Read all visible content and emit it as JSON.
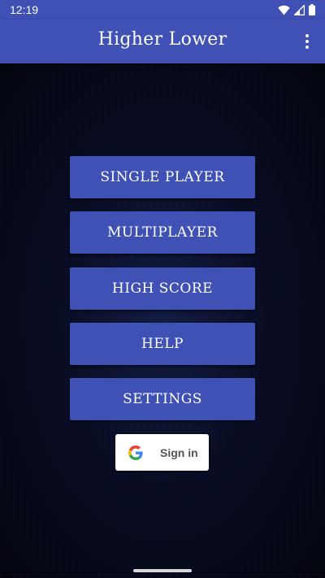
{
  "status_bar": {
    "time": "12:19",
    "icons": [
      "wifi-icon",
      "cellular-icon",
      "battery-icon"
    ]
  },
  "app_bar": {
    "title": "Higher Lower",
    "overflow_icon": "more-vert-icon"
  },
  "menu": {
    "single_player": "SINGLE PLAYER",
    "multiplayer": "MULTIPLAYER",
    "high_score": "HIGH SCORE",
    "help": "HELP",
    "settings": "SETTINGS"
  },
  "sign_in": {
    "label": "Sign in",
    "icon": "google-g-icon"
  },
  "colors": {
    "primary": "#3f51b5",
    "background": "#02030d",
    "text": "#ffffff"
  }
}
